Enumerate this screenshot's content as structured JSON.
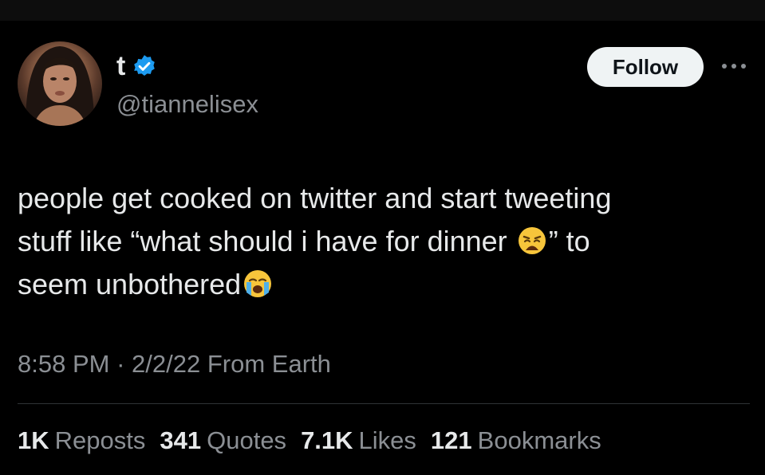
{
  "author": {
    "name": "t",
    "handle": "@tiannelisex",
    "verified": true
  },
  "follow_label": "Follow",
  "tweet": {
    "line1": "people get cooked on twitter and start tweeting",
    "line2_before": "stuff like “what should i have for dinner",
    "line2_after": "” to",
    "line3": "seem unbothered",
    "emoji_1": "weary-face-icon",
    "emoji_2": "loudly-crying-face-icon"
  },
  "meta": {
    "time": "8:58 PM",
    "separator": "·",
    "date": "2/2/22",
    "source": "From Earth"
  },
  "stats": [
    {
      "value": "1K",
      "label": "Reposts"
    },
    {
      "value": "341",
      "label": "Quotes"
    },
    {
      "value": "7.1K",
      "label": "Likes"
    },
    {
      "value": "121",
      "label": "Bookmarks"
    }
  ],
  "colors": {
    "background": "#000000",
    "text": "#e7e9ea",
    "muted": "#8b8f94",
    "verified_blue": "#1d9bf0",
    "follow_bg": "#eff3f4"
  }
}
